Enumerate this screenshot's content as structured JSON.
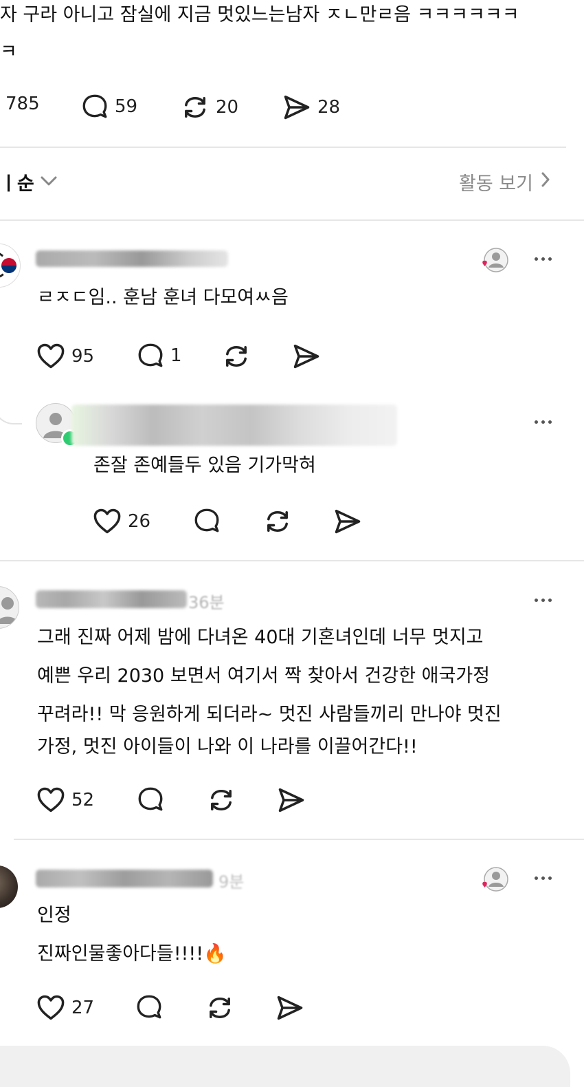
{
  "post": {
    "text_line1": "자 구라 아니고 잠실에 지금 멋있느는남자 ㅈㄴ만ㄹ음 ㅋㅋㅋㅋㅋㅋ",
    "text_line2": "ㅋ",
    "likes": "785",
    "comments": "59",
    "reposts": "20",
    "shares": "28"
  },
  "sort_bar": {
    "sort_label": "ㅣ순",
    "activity_label": "활동 보기"
  },
  "replies": [
    {
      "text": "ㄹㅈㄷ임.. 훈남 훈녀 다모여ㅆ음",
      "likes": "95",
      "comments": "1",
      "nested": {
        "text": "존잘 존예들두 있음 기가막혀",
        "likes": "26"
      }
    },
    {
      "timestamp": "36분",
      "lines": [
        "그래 진짜 어제 밤에 다녀온 40대 기혼녀인데 너무 멋지고",
        "예쁜 우리 2030 보면서 여기서 짝 찾아서 건강한 애국가정",
        "꾸려라!! 막 응원하게 되더라~ 멋진 사람들끼리 만나야 멋진",
        "가정, 멋진 아이들이 나와 이 나라를 이끌어간다!!"
      ],
      "likes": "52"
    },
    {
      "timestamp": "9분",
      "line1": "인정",
      "line2": "진짜인물좋아다들!!!!🔥",
      "likes": "27"
    }
  ],
  "icons": {
    "heart": "heart-icon",
    "comment": "comment-icon",
    "repost": "repost-icon",
    "share": "send-icon",
    "more": "more-icon",
    "chevron": "chevron-icon"
  },
  "colors": {
    "like_badge": "#e0245e",
    "online_dot": "#2ecc71",
    "divider": "#e6e6e6",
    "muted": "#8a8a8a"
  }
}
